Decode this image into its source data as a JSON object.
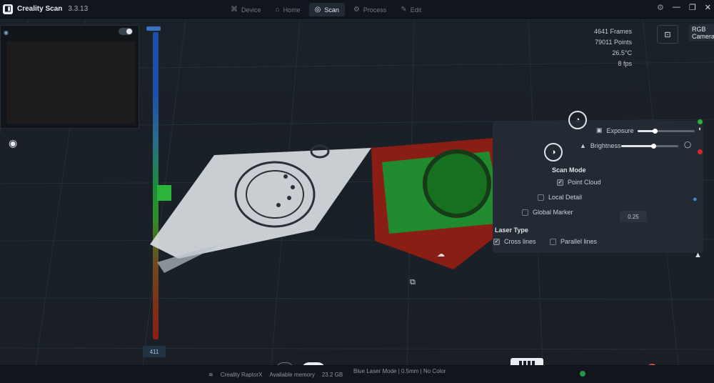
{
  "app": {
    "name": "Creality Scan",
    "version": "3.3.13"
  },
  "tabs": [
    {
      "label": "Device",
      "icon": "device-icon",
      "active": false
    },
    {
      "label": "Home",
      "icon": "home-icon",
      "active": false
    },
    {
      "label": "Scan",
      "icon": "scan-icon",
      "active": true
    },
    {
      "label": "Process",
      "icon": "process-icon",
      "active": false
    },
    {
      "label": "Edit",
      "icon": "edit-icon",
      "active": false
    }
  ],
  "info": {
    "frames": "4641 Frames",
    "points": "79011 Points",
    "temperature": "26.5°C",
    "fps": "8 fps"
  },
  "camera": {
    "label": "RGB Camera"
  },
  "settings": {
    "exposure_label": "Exposure",
    "exposure_level": 0.3,
    "brightness_label": "Brightness",
    "brightness_level": 0.57,
    "scan_mode_title": "Scan Mode",
    "scan_modes": [
      {
        "label": "Point Cloud",
        "checked": true
      },
      {
        "label": "Local Detail",
        "checked": false
      },
      {
        "label": "Global Marker",
        "checked": false
      }
    ],
    "detail_value": "0.25",
    "laser_type_title": "Laser Type",
    "laser_types": [
      {
        "label": "Cross lines",
        "checked": true
      },
      {
        "label": "Parallel lines",
        "checked": false
      }
    ]
  },
  "depth_readout": "411",
  "status": {
    "device": "Creality RaptorX",
    "memory_label": "Available memory",
    "memory_value": "23.2 GB",
    "mode": "Blue Laser Mode | 0.5mm | No Color"
  },
  "colors": {
    "accent": "#3a72c2",
    "status_ok": "#1f9a46",
    "cloud_green": "#1f8a2e",
    "cloud_red": "#8a1e14"
  }
}
